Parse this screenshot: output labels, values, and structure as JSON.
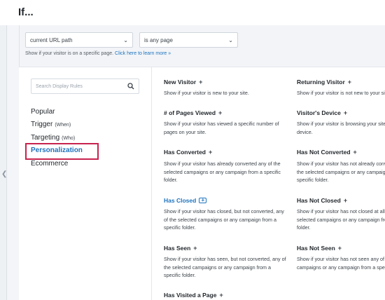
{
  "header": {
    "title": "If..."
  },
  "filters": {
    "condition": "current URL path",
    "operator": "is any page",
    "help_text": "Show if your visitor is on a specific page.",
    "help_link": "Click here to learn more »"
  },
  "sidebar": {
    "search_placeholder": "Search Display Rules",
    "categories": [
      {
        "label": "Popular",
        "sub": ""
      },
      {
        "label": "Trigger",
        "sub": "(When)"
      },
      {
        "label": "Targeting",
        "sub": "(Who)"
      },
      {
        "label": "Personalization",
        "sub": ""
      },
      {
        "label": "Ecommerce",
        "sub": ""
      }
    ],
    "active_category": "Personalization"
  },
  "rules": {
    "new_visitor": {
      "title": "New Visitor",
      "desc": "Show if your visitor is new to your site."
    },
    "returning_visitor": {
      "title": "Returning Visitor",
      "desc": "Show if your visitor is not new to your site."
    },
    "pages_viewed": {
      "title": "# of Pages Viewed",
      "desc": "Show if your visitor has viewed a specific number of pages on your site."
    },
    "visitor_device": {
      "title": "Visitor's Device",
      "desc": "Show if your visitor is browsing your site from a specific device."
    },
    "has_converted": {
      "title": "Has Converted",
      "desc": "Show if your visitor has already converted any of the selected campaigns or any campaign from a specific folder."
    },
    "has_not_converted": {
      "title": "Has Not Converted",
      "desc": "Show if your visitor has not already converted any of the selected campaigns or any campaign from a specific folder."
    },
    "has_closed": {
      "title": "Has Closed",
      "desc": "Show if your visitor has closed, but not converted, any of the selected campaigns or any campaign from a specific folder."
    },
    "has_not_closed": {
      "title": "Has Not Closed",
      "desc": "Show if your visitor has not closed at all any of the selected campaigns or any campaign from a specific folder."
    },
    "has_seen": {
      "title": "Has Seen",
      "desc": "Show if your visitor has seen, but not converted, any of the selected campaigns or any campaign from a specific folder."
    },
    "has_not_seen": {
      "title": "Has Not Seen",
      "desc": "Show if your visitor has not seen any of the selected campaigns or any campaign from a specific folder."
    },
    "has_visited_page": {
      "title": "Has Visited a Page",
      "desc": ""
    }
  },
  "colors": {
    "accent": "#1e73be",
    "highlight": "#c8234e"
  }
}
